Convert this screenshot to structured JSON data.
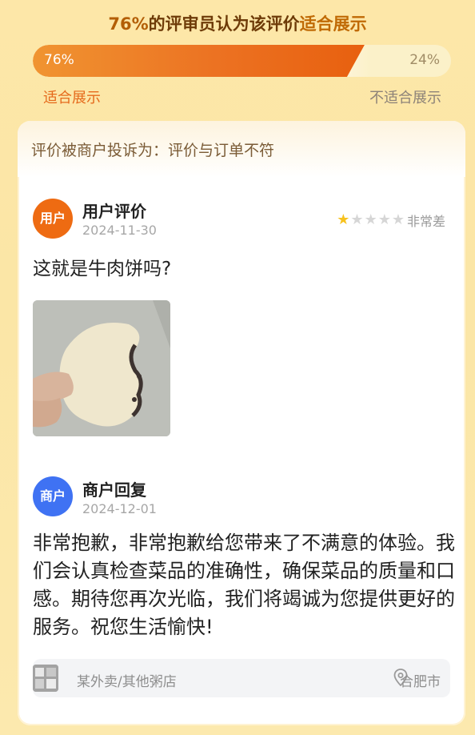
{
  "header": {
    "percent_text": "76%",
    "headline_middle": "的评审员认为该评价",
    "headline_highlight": "适合展示"
  },
  "vote_bar": {
    "suitable_percent": 76,
    "suitable_label": "76%",
    "unsuitable_label": "24%",
    "left_caption": "适合展示",
    "right_caption": "不适合展示",
    "colors": {
      "fill": "#ec7222",
      "track": "#fbf1c9"
    }
  },
  "complaint": {
    "text": "评价被商户投诉为：评价与订单不符"
  },
  "user_review": {
    "avatar_label": "用户",
    "title": "用户评价",
    "date": "2024-11-30",
    "rating": 1,
    "rating_max": 5,
    "rating_label": "非常差",
    "text": "这就是牛肉饼吗?"
  },
  "merchant_reply": {
    "avatar_label": "商户",
    "title": "商户回复",
    "date": "2024-12-01",
    "text": "非常抱歉，非常抱歉给您带来了不满意的体验。我们会认真检查菜品的准确性，确保菜品的质量和口感。期待您再次光临，我们将竭诚为您提供更好的服务。祝您生活愉快!"
  },
  "footer": {
    "shop_name": "某外卖/其他粥店",
    "location": "合肥市",
    "icons": {
      "shop": "shop-thumbnail-icon",
      "location": "location-pin-icon"
    }
  }
}
